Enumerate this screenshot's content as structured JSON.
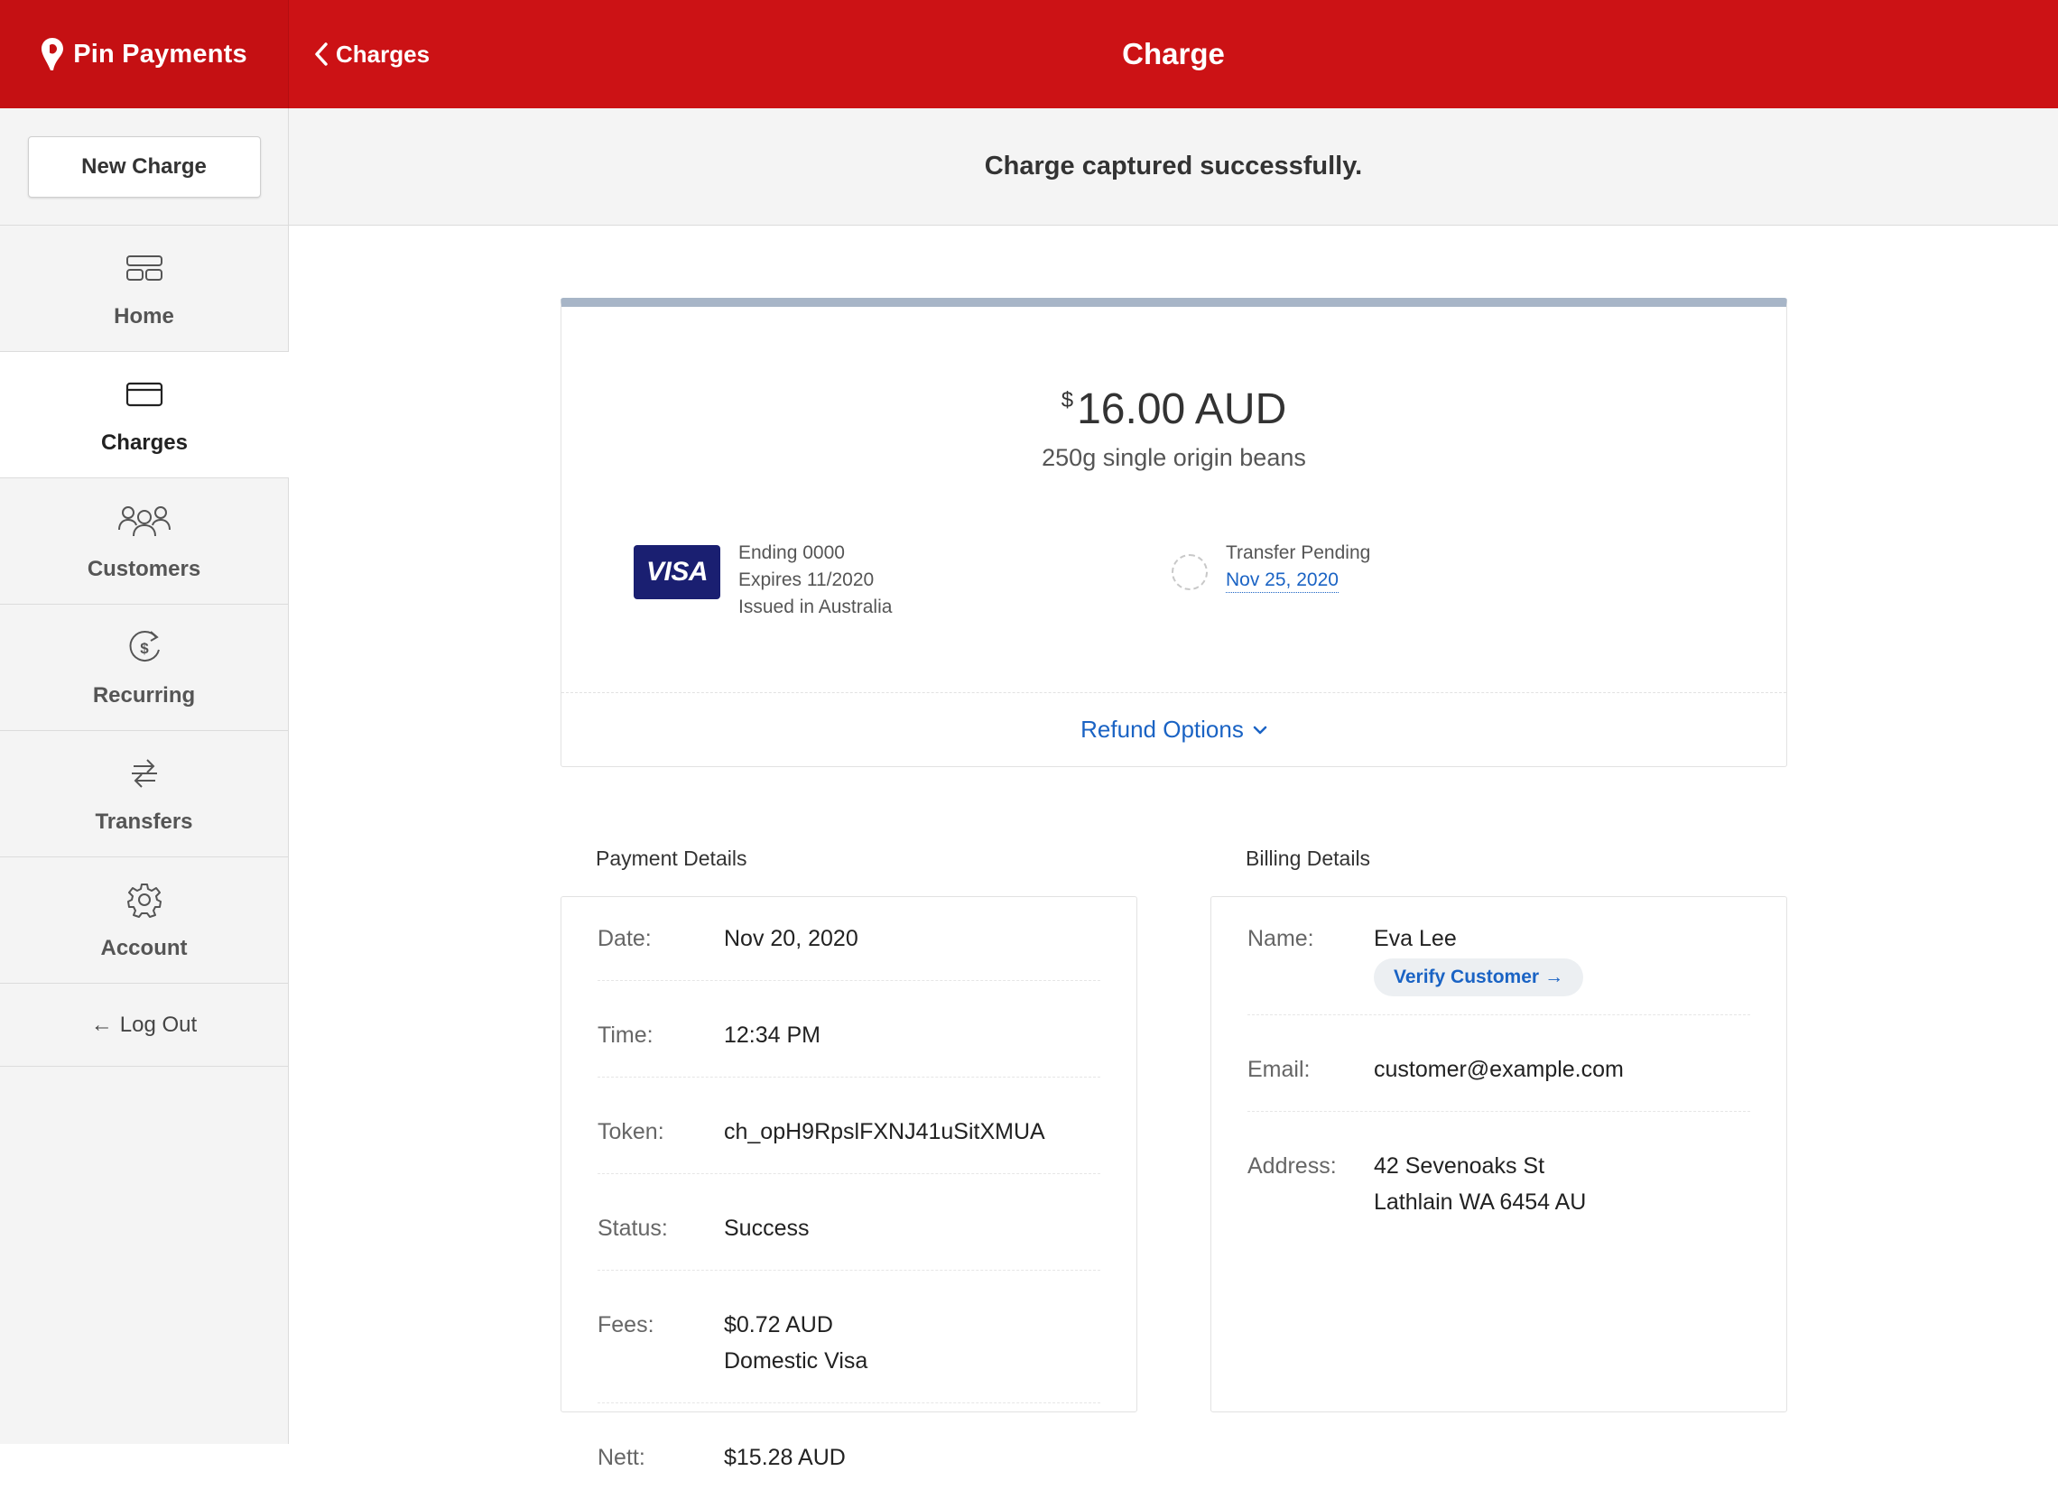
{
  "brand": {
    "name": "Pin Payments"
  },
  "header": {
    "back_label": "Charges",
    "title": "Charge"
  },
  "sidebar": {
    "new_charge_label": "New Charge",
    "items": [
      {
        "label": "Home",
        "icon": "home-icon"
      },
      {
        "label": "Charges",
        "icon": "credit-card-icon",
        "active": true
      },
      {
        "label": "Customers",
        "icon": "users-icon"
      },
      {
        "label": "Recurring",
        "icon": "recurring-dollar-icon"
      },
      {
        "label": "Transfers",
        "icon": "transfers-icon"
      },
      {
        "label": "Account",
        "icon": "gear-icon"
      }
    ],
    "logout_arrow": "←",
    "logout_label": "Log Out"
  },
  "flash": {
    "message": "Charge captured successfully."
  },
  "charge": {
    "currency_symbol": "$",
    "amount": "16.00 AUD",
    "description": "250g single origin beans",
    "card": {
      "brand": "VISA",
      "ending": "Ending 0000",
      "expires": "Expires 11/2020",
      "issued": "Issued in Australia"
    },
    "transfer": {
      "status": "Transfer Pending",
      "date": "Nov 25, 2020"
    },
    "refund_label": "Refund Options"
  },
  "payment_details": {
    "title": "Payment Details",
    "rows": [
      {
        "label": "Date:",
        "value": "Nov 20, 2020"
      },
      {
        "label": "Time:",
        "value": "12:34 PM"
      },
      {
        "label": "Token:",
        "value": "ch_opH9RpslFXNJ41uSitXMUA"
      },
      {
        "label": "Status:",
        "value": "Success"
      },
      {
        "label": "Fees:",
        "value": "$0.72 AUD",
        "value2": "Domestic Visa"
      },
      {
        "label": "Nett:",
        "value": "$15.28 AUD"
      }
    ]
  },
  "billing_details": {
    "title": "Billing Details",
    "name_label": "Name:",
    "name": "Eva Lee",
    "verify_label": "Verify Customer",
    "verify_arrow": "→",
    "email_label": "Email:",
    "email": "customer@example.com",
    "address_label": "Address:",
    "address_line1": "42 Sevenoaks St",
    "address_line2": "Lathlain WA 6454 AU"
  },
  "colors": {
    "brand_red": "#cc1215",
    "link_blue": "#1a63c4",
    "visa_navy": "#1a1f71",
    "card_top_border": "#a7b5c7"
  }
}
